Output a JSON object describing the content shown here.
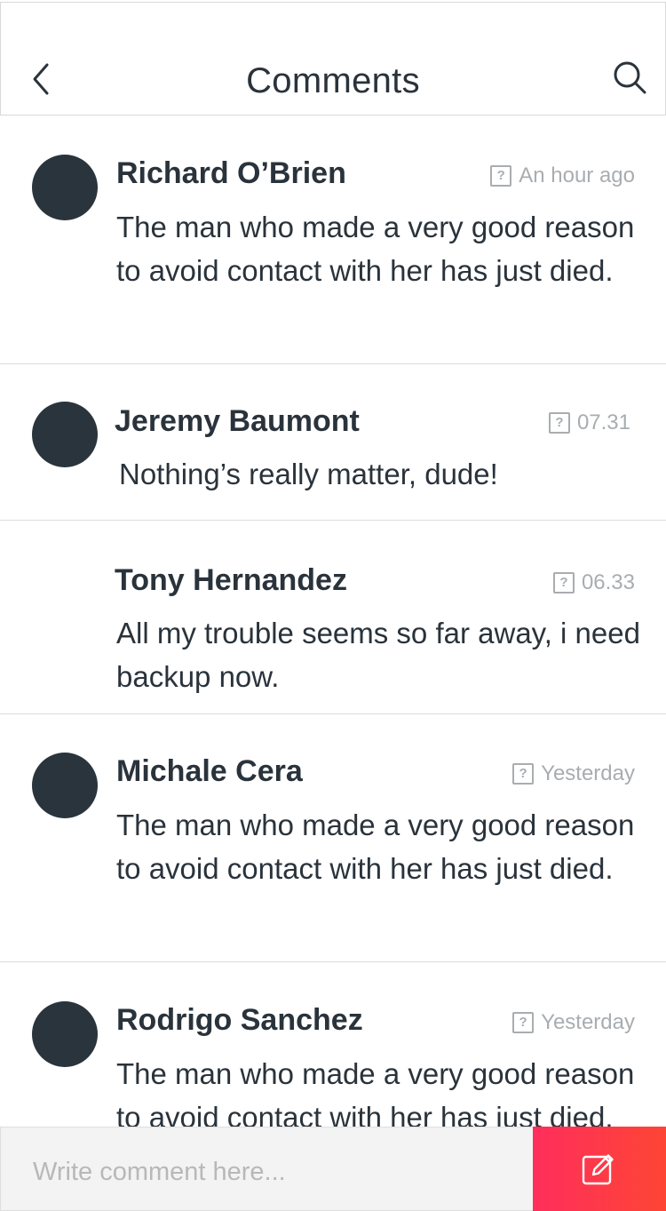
{
  "header": {
    "title": "Comments",
    "back_icon": "chevron-left-icon",
    "search_icon": "search-icon"
  },
  "comments": [
    {
      "name": "Richard O’Brien",
      "time": "An hour ago",
      "text": "The man who made a very good reason to avoid contact with her has just died.",
      "has_avatar": true
    },
    {
      "name": "Jeremy Baumont",
      "time": "07.31",
      "text": "Nothing’s really matter, dude!",
      "has_avatar": true
    },
    {
      "name": "Tony Hernandez",
      "time": "06.33",
      "text": "All my trouble seems so far away, i need backup now.",
      "has_avatar": false
    },
    {
      "name": "Michale Cera",
      "time": "Yesterday",
      "text": "The man who made a very good reason to avoid contact with her has just died.",
      "has_avatar": true
    },
    {
      "name": "Rodrigo Sanchez",
      "time": "Yesterday",
      "text": "The man who made a very good reason to avoid contact with her has just died.",
      "has_avatar": true
    }
  ],
  "composer": {
    "placeholder": "Write comment here...",
    "send_icon": "edit-icon"
  },
  "colors": {
    "avatar": "#29343c",
    "accent_start": "#ff2e5c",
    "accent_end": "#fd4534",
    "muted_text": "#a9adb0"
  }
}
